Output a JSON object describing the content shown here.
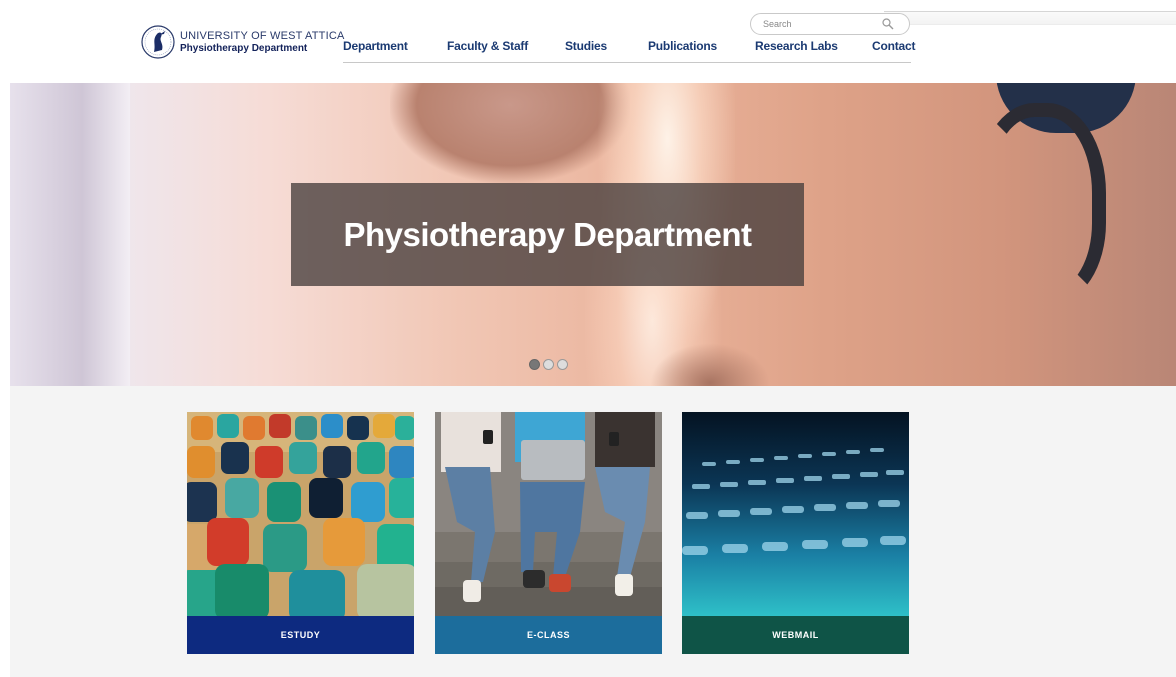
{
  "logo": {
    "university": "UNIVERSITY OF WEST ATTICA",
    "department": "Physiotherapy Department"
  },
  "search": {
    "placeholder": "Search",
    "icon": "search-icon"
  },
  "nav": {
    "items": [
      {
        "label": "Department"
      },
      {
        "label": "Faculty & Staff"
      },
      {
        "label": "Studies"
      },
      {
        "label": "Publications"
      },
      {
        "label": "Research Labs"
      },
      {
        "label": "Contact"
      }
    ]
  },
  "hero": {
    "title": "Physiotherapy Department",
    "slides_total": 3,
    "active_slide": 1
  },
  "cards": [
    {
      "label": "ESTUDY",
      "color": "#0d2a80"
    },
    {
      "label": "E-CLASS",
      "color": "#1c6d9c"
    },
    {
      "label": "WEBMAIL",
      "color": "#0f5447"
    }
  ],
  "colors": {
    "nav_text": "#1b3a72",
    "hero_box": "#463e3c"
  }
}
